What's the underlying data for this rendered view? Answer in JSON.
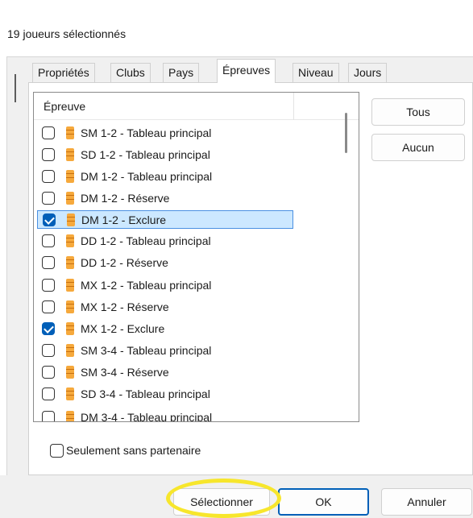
{
  "header": {
    "selection_count_text": "19 joueurs sélectionnés"
  },
  "tabs": [
    {
      "label": "Propriétés"
    },
    {
      "label": "Clubs"
    },
    {
      "label": "Pays"
    },
    {
      "label": "Épreuves",
      "active": true
    },
    {
      "label": "Niveau"
    },
    {
      "label": "Jours"
    }
  ],
  "events_list": {
    "column_header": "Épreuve",
    "items": [
      {
        "label": "SM 1-2 - Tableau principal",
        "checked": false
      },
      {
        "label": "SD 1-2 - Tableau principal",
        "checked": false
      },
      {
        "label": "DM 1-2 - Tableau principal",
        "checked": false
      },
      {
        "label": "DM 1-2 - Réserve",
        "checked": false
      },
      {
        "label": "DM 1-2 - Exclure",
        "checked": true,
        "selected": true
      },
      {
        "label": "DD 1-2 - Tableau principal",
        "checked": false
      },
      {
        "label": "DD 1-2 - Réserve",
        "checked": false
      },
      {
        "label": "MX 1-2 - Tableau principal",
        "checked": false
      },
      {
        "label": "MX 1-2 - Réserve",
        "checked": false
      },
      {
        "label": "MX 1-2 - Exclure",
        "checked": true
      },
      {
        "label": "SM 3-4 - Tableau principal",
        "checked": false
      },
      {
        "label": "SM 3-4 - Réserve",
        "checked": false
      },
      {
        "label": "SD 3-4 - Tableau principal",
        "checked": false
      },
      {
        "label": "DM 3-4 - Tableau principal",
        "checked": false
      }
    ]
  },
  "side_buttons": {
    "all_label": "Tous",
    "none_label": "Aucun"
  },
  "only_without_partner": {
    "label": "Seulement sans partenaire",
    "checked": false
  },
  "footer_buttons": {
    "select_label": "Sélectionner",
    "ok_label": "OK",
    "cancel_label": "Annuler"
  },
  "colors": {
    "accent": "#005fb8",
    "highlight": "#f7e62c",
    "selection_bg": "#cce8ff",
    "icon": "#f6a93c"
  },
  "icons": {
    "event_icon": "database-icon",
    "check_icon": "checkmark-icon"
  }
}
